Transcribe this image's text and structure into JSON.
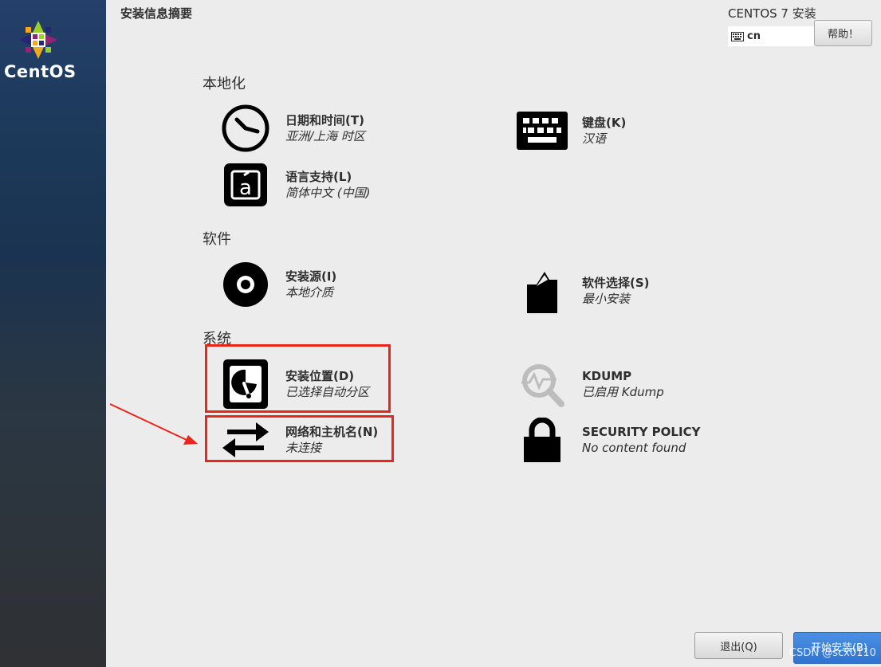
{
  "sidebar": {
    "brand": "CentOS"
  },
  "header": {
    "page_title": "安装信息摘要",
    "product_title": "CENTOS 7 安装",
    "keyboard_layout": "cn",
    "help_label": "帮助！"
  },
  "sections": {
    "localization": {
      "title": "本地化",
      "datetime": {
        "label": "日期和时间(T)",
        "status": "亚洲/上海 时区",
        "icon": "clock-icon"
      },
      "keyboard": {
        "label": "键盘(K)",
        "status": "汉语",
        "icon": "keyboard-icon"
      },
      "language": {
        "label": "语言支持(L)",
        "status": "简体中文 (中国)",
        "icon": "language-icon"
      }
    },
    "software": {
      "title": "软件",
      "source": {
        "label": "安装源(I)",
        "status": "本地介质",
        "icon": "disc-icon"
      },
      "selection": {
        "label": "软件选择(S)",
        "status": "最小安装",
        "icon": "package-icon"
      }
    },
    "system": {
      "title": "系统",
      "destination": {
        "label": "安装位置(D)",
        "status": "已选择自动分区",
        "icon": "harddisk-icon"
      },
      "kdump": {
        "label": "KDUMP",
        "status": "已启用 Kdump",
        "icon": "kdump-search-icon"
      },
      "network": {
        "label": "网络和主机名(N)",
        "status": "未连接",
        "icon": "network-arrows-icon"
      },
      "security": {
        "label": "SECURITY POLICY",
        "status": "No content found",
        "icon": "lock-icon"
      }
    }
  },
  "footer": {
    "quit_label": "退出(Q)",
    "begin_label": "开始安装(B)",
    "watermark": "CSDN @scx0110"
  },
  "annotations": {
    "highlight_color": "#e8261c"
  }
}
